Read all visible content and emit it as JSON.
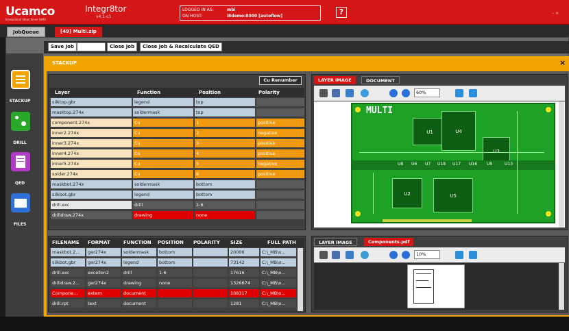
{
  "header": {
    "logo": "Ucamco",
    "logo_sub": "Exceptional Ideas Since 1894",
    "app_title": "Integr8tor",
    "app_version": "v4.1-c1",
    "logged_in_label": "LOGGED IN AS:",
    "logged_in_value": "mbi",
    "on_host_label": "ON HOST:",
    "on_host_value": "i8demo:8000 [autoflow]",
    "help": "?",
    "window_controls": "- ×"
  },
  "tabs": [
    {
      "label": "JobQueue"
    },
    {
      "label": "[49] Multi.zip"
    }
  ],
  "toolbar": {
    "save_job": "Save Job",
    "close_job": "Close Job",
    "close_recalc": "Close Job & Recalculate QED"
  },
  "stackup_title": "STACKUP",
  "close_x": "×",
  "nav": [
    {
      "label": "STACKUP",
      "color": "#f0a500"
    },
    {
      "label": "DRILL",
      "color": "#2aa82a"
    },
    {
      "label": "QED",
      "color": "#b03cc8"
    },
    {
      "label": "FILES",
      "color": "#2f6fd8"
    }
  ],
  "stackup_table": {
    "renumber_button": "Cu Renumber",
    "columns": [
      "Layer",
      "Function",
      "Position",
      "Polarity"
    ],
    "rows": [
      {
        "layer": "silktop.gbr",
        "function": "legend",
        "position": "top",
        "polarity": "",
        "color": "bl"
      },
      {
        "layer": "masktop.274x",
        "function": "soldermask",
        "position": "top",
        "polarity": "",
        "color": "bl"
      },
      {
        "layer": "component.274x",
        "function": "Cu",
        "position": "1",
        "polarity": "positive",
        "color": "or"
      },
      {
        "layer": "inner2.274x",
        "function": "Cu",
        "position": "2",
        "polarity": "negative",
        "color": "or"
      },
      {
        "layer": "inner3.274x",
        "function": "Cu",
        "position": "3",
        "polarity": "positive",
        "color": "or"
      },
      {
        "layer": "inner4.274x",
        "function": "Cu",
        "position": "4",
        "polarity": "positive",
        "color": "or"
      },
      {
        "layer": "inner5.274x",
        "function": "Cu",
        "position": "5",
        "polarity": "negative",
        "color": "or"
      },
      {
        "layer": "solder.274x",
        "function": "Cu",
        "position": "6",
        "polarity": "positive",
        "color": "or"
      },
      {
        "layer": "maskbot.274x",
        "function": "soldermask",
        "position": "bottom",
        "polarity": "",
        "color": "bl"
      },
      {
        "layer": "silkbot.gbr",
        "function": "legend",
        "position": "bottom",
        "polarity": "",
        "color": "bl"
      },
      {
        "layer": "drill.exc",
        "function": "drill",
        "position": "1-6",
        "polarity": "",
        "color": "gr"
      },
      {
        "layer": "drilldraw.274x",
        "function": "drawing",
        "position": "none",
        "polarity": "",
        "color": "rd"
      }
    ]
  },
  "files_table": {
    "columns": [
      "FILENAME",
      "FORMAT",
      "FUNCTION",
      "POSITION",
      "POLARITY",
      "SIZE",
      "FULL PATH"
    ],
    "rows": [
      {
        "filename": "maskbot.2...",
        "format": "ger274x",
        "function": "soldermask",
        "position": "bottom",
        "polarity": "",
        "size": "20006",
        "path": "C:\\_MB\\o...",
        "color": "bl"
      },
      {
        "filename": "silkbot.gbr",
        "format": "ger274x",
        "function": "legend",
        "position": "bottom",
        "polarity": "",
        "size": "73142",
        "path": "C:\\_MB\\o...",
        "color": "bl"
      },
      {
        "filename": "drill.exc",
        "format": "excellon2",
        "function": "drill",
        "position": "1-6",
        "polarity": "",
        "size": "17616",
        "path": "C:\\_MB\\o...",
        "color": "dk"
      },
      {
        "filename": "drilldraw.2...",
        "format": "ger274x",
        "function": "drawing",
        "position": "none",
        "polarity": "",
        "size": "1326674",
        "path": "C:\\_MB\\o...",
        "color": "dk"
      },
      {
        "filename": "Compone...",
        "format": "extern",
        "function": "document",
        "position": "",
        "polarity": "",
        "size": "108317",
        "path": "C:\\_MB\\o...",
        "color": "rd"
      },
      {
        "filename": "drill.rpt",
        "format": "text",
        "function": "document",
        "position": "",
        "polarity": "",
        "size": "1281",
        "path": "C:\\_MB\\o...",
        "color": "dk"
      }
    ]
  },
  "viewer_top": {
    "tab_active": "LAYER IMAGE",
    "tab_other": "DOCUMENT",
    "zoom": "60%"
  },
  "viewer_bottom": {
    "tab_other": "LAYER IMAGE",
    "tab_active": "Components.pdf",
    "zoom": "10%"
  },
  "pcb": {
    "title": "MULTI",
    "chips": [
      "U1",
      "U4",
      "U3",
      "U2",
      "U5"
    ],
    "small_labels": [
      "U8",
      "U6",
      "U7",
      "U18",
      "U17",
      "U16",
      "U9",
      "U13"
    ]
  }
}
